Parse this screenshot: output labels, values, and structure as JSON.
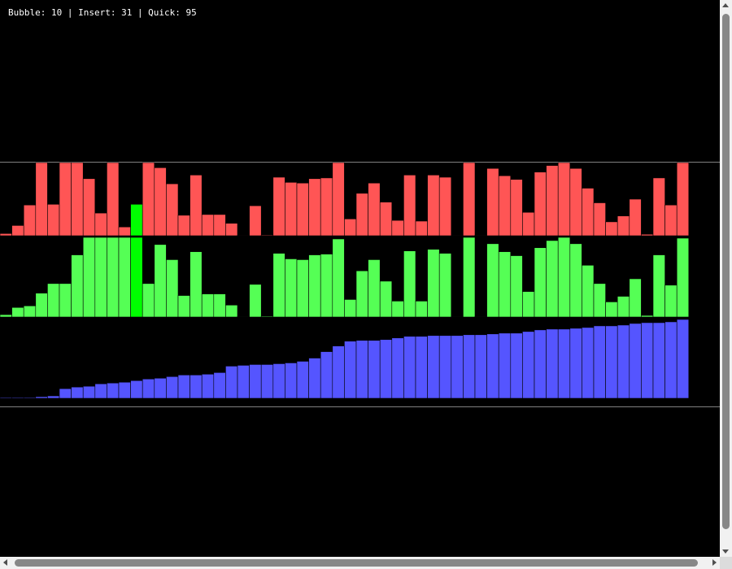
{
  "status": {
    "bubble_label": "Bubble",
    "bubble_count": 10,
    "insert_label": "Insert",
    "insert_count": 31,
    "quick_label": "Quick",
    "quick_count": 95,
    "text": "Bubble: 10 | Insert: 31 | Quick: 95"
  },
  "colors": {
    "background": "#000000",
    "bubble_bar": "#ff5555",
    "insert_bar": "#55ff55",
    "quick_bar": "#5555ff",
    "highlight": "#00ff00",
    "divider": "#808080",
    "bar_stroke": "#000000"
  },
  "chart_data": [
    {
      "type": "bar",
      "name": "Bubble",
      "highlight_index": 11,
      "values": [
        3,
        14,
        42,
        100,
        43,
        100,
        100,
        78,
        31,
        100,
        12,
        43,
        100,
        93,
        71,
        28,
        83,
        29,
        29,
        17,
        0,
        41,
        1,
        80,
        73,
        72,
        78,
        79,
        100,
        23,
        58,
        72,
        46,
        21,
        83,
        20,
        83,
        80,
        0,
        100,
        0,
        92,
        82,
        77,
        32,
        87,
        96,
        100,
        92,
        65,
        45,
        19,
        27,
        50,
        2,
        79,
        42,
        100
      ]
    },
    {
      "type": "bar",
      "name": "Insert",
      "highlight_index": 11,
      "values": [
        3,
        12,
        14,
        30,
        42,
        42,
        78,
        100,
        100,
        100,
        100,
        100,
        42,
        91,
        72,
        27,
        82,
        29,
        29,
        15,
        0,
        41,
        1,
        80,
        73,
        72,
        78,
        79,
        98,
        22,
        58,
        72,
        45,
        20,
        83,
        20,
        85,
        80,
        0,
        100,
        0,
        92,
        82,
        77,
        32,
        87,
        96,
        100,
        92,
        65,
        42,
        19,
        26,
        48,
        2,
        78,
        40,
        99
      ]
    },
    {
      "type": "bar",
      "name": "Quick",
      "values": [
        1,
        1,
        1,
        2,
        3,
        12,
        14,
        15,
        18,
        19,
        20,
        22,
        24,
        25,
        27,
        29,
        29,
        30,
        32,
        40,
        41,
        42,
        42,
        43,
        44,
        46,
        50,
        58,
        65,
        71,
        72,
        72,
        73,
        75,
        77,
        77,
        78,
        78,
        78,
        79,
        79,
        80,
        81,
        81,
        83,
        85,
        86,
        86,
        87,
        88,
        90,
        90,
        91,
        93,
        94,
        94,
        95,
        98
      ]
    }
  ]
}
